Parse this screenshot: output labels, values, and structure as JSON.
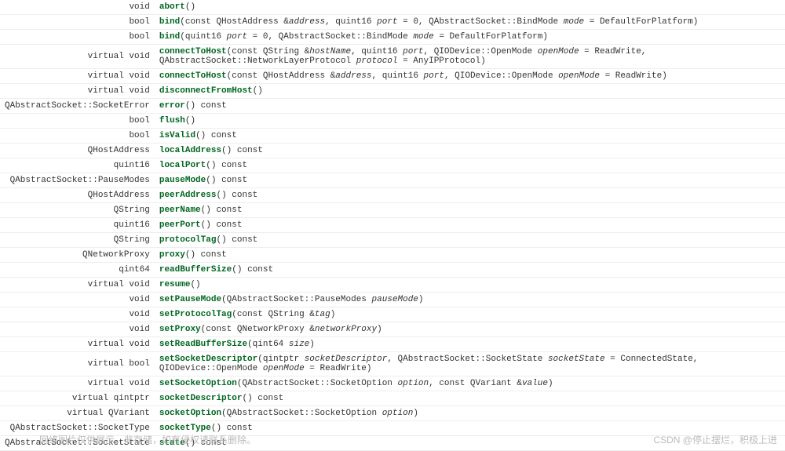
{
  "api": {
    "rows": [
      {
        "ret": "void",
        "fn": "abort",
        "sig": "()"
      },
      {
        "ret": "bool",
        "fn": "bind",
        "sig": "(const QHostAddress &<i>address</i>, quint16 <i>port</i> = 0, QAbstractSocket::BindMode <i>mode</i> = DefaultForPlatform)"
      },
      {
        "ret": "bool",
        "fn": "bind",
        "sig": "(quint16 <i>port</i> = 0, QAbstractSocket::BindMode <i>mode</i> = DefaultForPlatform)"
      },
      {
        "ret": "virtual void",
        "fn": "connectToHost",
        "sig": "(const QString &<i>hostName</i>, quint16 <i>port</i>, QIODevice::OpenMode <i>openMode</i> = ReadWrite, QAbstractSocket::NetworkLayerProtocol <i>protocol</i> = AnyIPProtocol)"
      },
      {
        "ret": "virtual void",
        "fn": "connectToHost",
        "sig": "(const QHostAddress &<i>address</i>, quint16 <i>port</i>, QIODevice::OpenMode <i>openMode</i> = ReadWrite)"
      },
      {
        "ret": "virtual void",
        "fn": "disconnectFromHost",
        "sig": "()"
      },
      {
        "ret": "QAbstractSocket::SocketError",
        "fn": "error",
        "sig": "() const"
      },
      {
        "ret": "bool",
        "fn": "flush",
        "sig": "()"
      },
      {
        "ret": "bool",
        "fn": "isValid",
        "sig": "() const"
      },
      {
        "ret": "QHostAddress",
        "fn": "localAddress",
        "sig": "() const"
      },
      {
        "ret": "quint16",
        "fn": "localPort",
        "sig": "() const"
      },
      {
        "ret": "QAbstractSocket::PauseModes",
        "fn": "pauseMode",
        "sig": "() const"
      },
      {
        "ret": "QHostAddress",
        "fn": "peerAddress",
        "sig": "() const"
      },
      {
        "ret": "QString",
        "fn": "peerName",
        "sig": "() const"
      },
      {
        "ret": "quint16",
        "fn": "peerPort",
        "sig": "() const"
      },
      {
        "ret": "QString",
        "fn": "protocolTag",
        "sig": "() const"
      },
      {
        "ret": "QNetworkProxy",
        "fn": "proxy",
        "sig": "() const"
      },
      {
        "ret": "qint64",
        "fn": "readBufferSize",
        "sig": "() const"
      },
      {
        "ret": "virtual void",
        "fn": "resume",
        "sig": "()"
      },
      {
        "ret": "void",
        "fn": "setPauseMode",
        "sig": "(QAbstractSocket::PauseModes <i>pauseMode</i>)"
      },
      {
        "ret": "void",
        "fn": "setProtocolTag",
        "sig": "(const QString &<i>tag</i>)"
      },
      {
        "ret": "void",
        "fn": "setProxy",
        "sig": "(const QNetworkProxy &<i>networkProxy</i>)"
      },
      {
        "ret": "virtual void",
        "fn": "setReadBufferSize",
        "sig": "(qint64 <i>size</i>)"
      },
      {
        "ret": "virtual bool",
        "fn": "setSocketDescriptor",
        "sig": "(qintptr <i>socketDescriptor</i>, QAbstractSocket::SocketState <i>socketState</i> = ConnectedState, QIODevice::OpenMode <i>openMode</i> = ReadWrite)"
      },
      {
        "ret": "virtual void",
        "fn": "setSocketOption",
        "sig": "(QAbstractSocket::SocketOption <i>option</i>, const QVariant &<i>value</i>)"
      },
      {
        "ret": "virtual qintptr",
        "fn": "socketDescriptor",
        "sig": "() const"
      },
      {
        "ret": "virtual QVariant",
        "fn": "socketOption",
        "sig": "(QAbstractSocket::SocketOption <i>option</i>)"
      },
      {
        "ret": "QAbstractSocket::SocketType",
        "fn": "socketType",
        "sig": "() const"
      },
      {
        "ret": "QAbstractSocket::SocketState",
        "fn": "state",
        "sig": "() const"
      }
    ]
  },
  "watermark_left": "网络图片仅供展示，非存储，如有侵权请联系删除。",
  "watermark_right": "CSDN @停止摆烂，积极上进"
}
